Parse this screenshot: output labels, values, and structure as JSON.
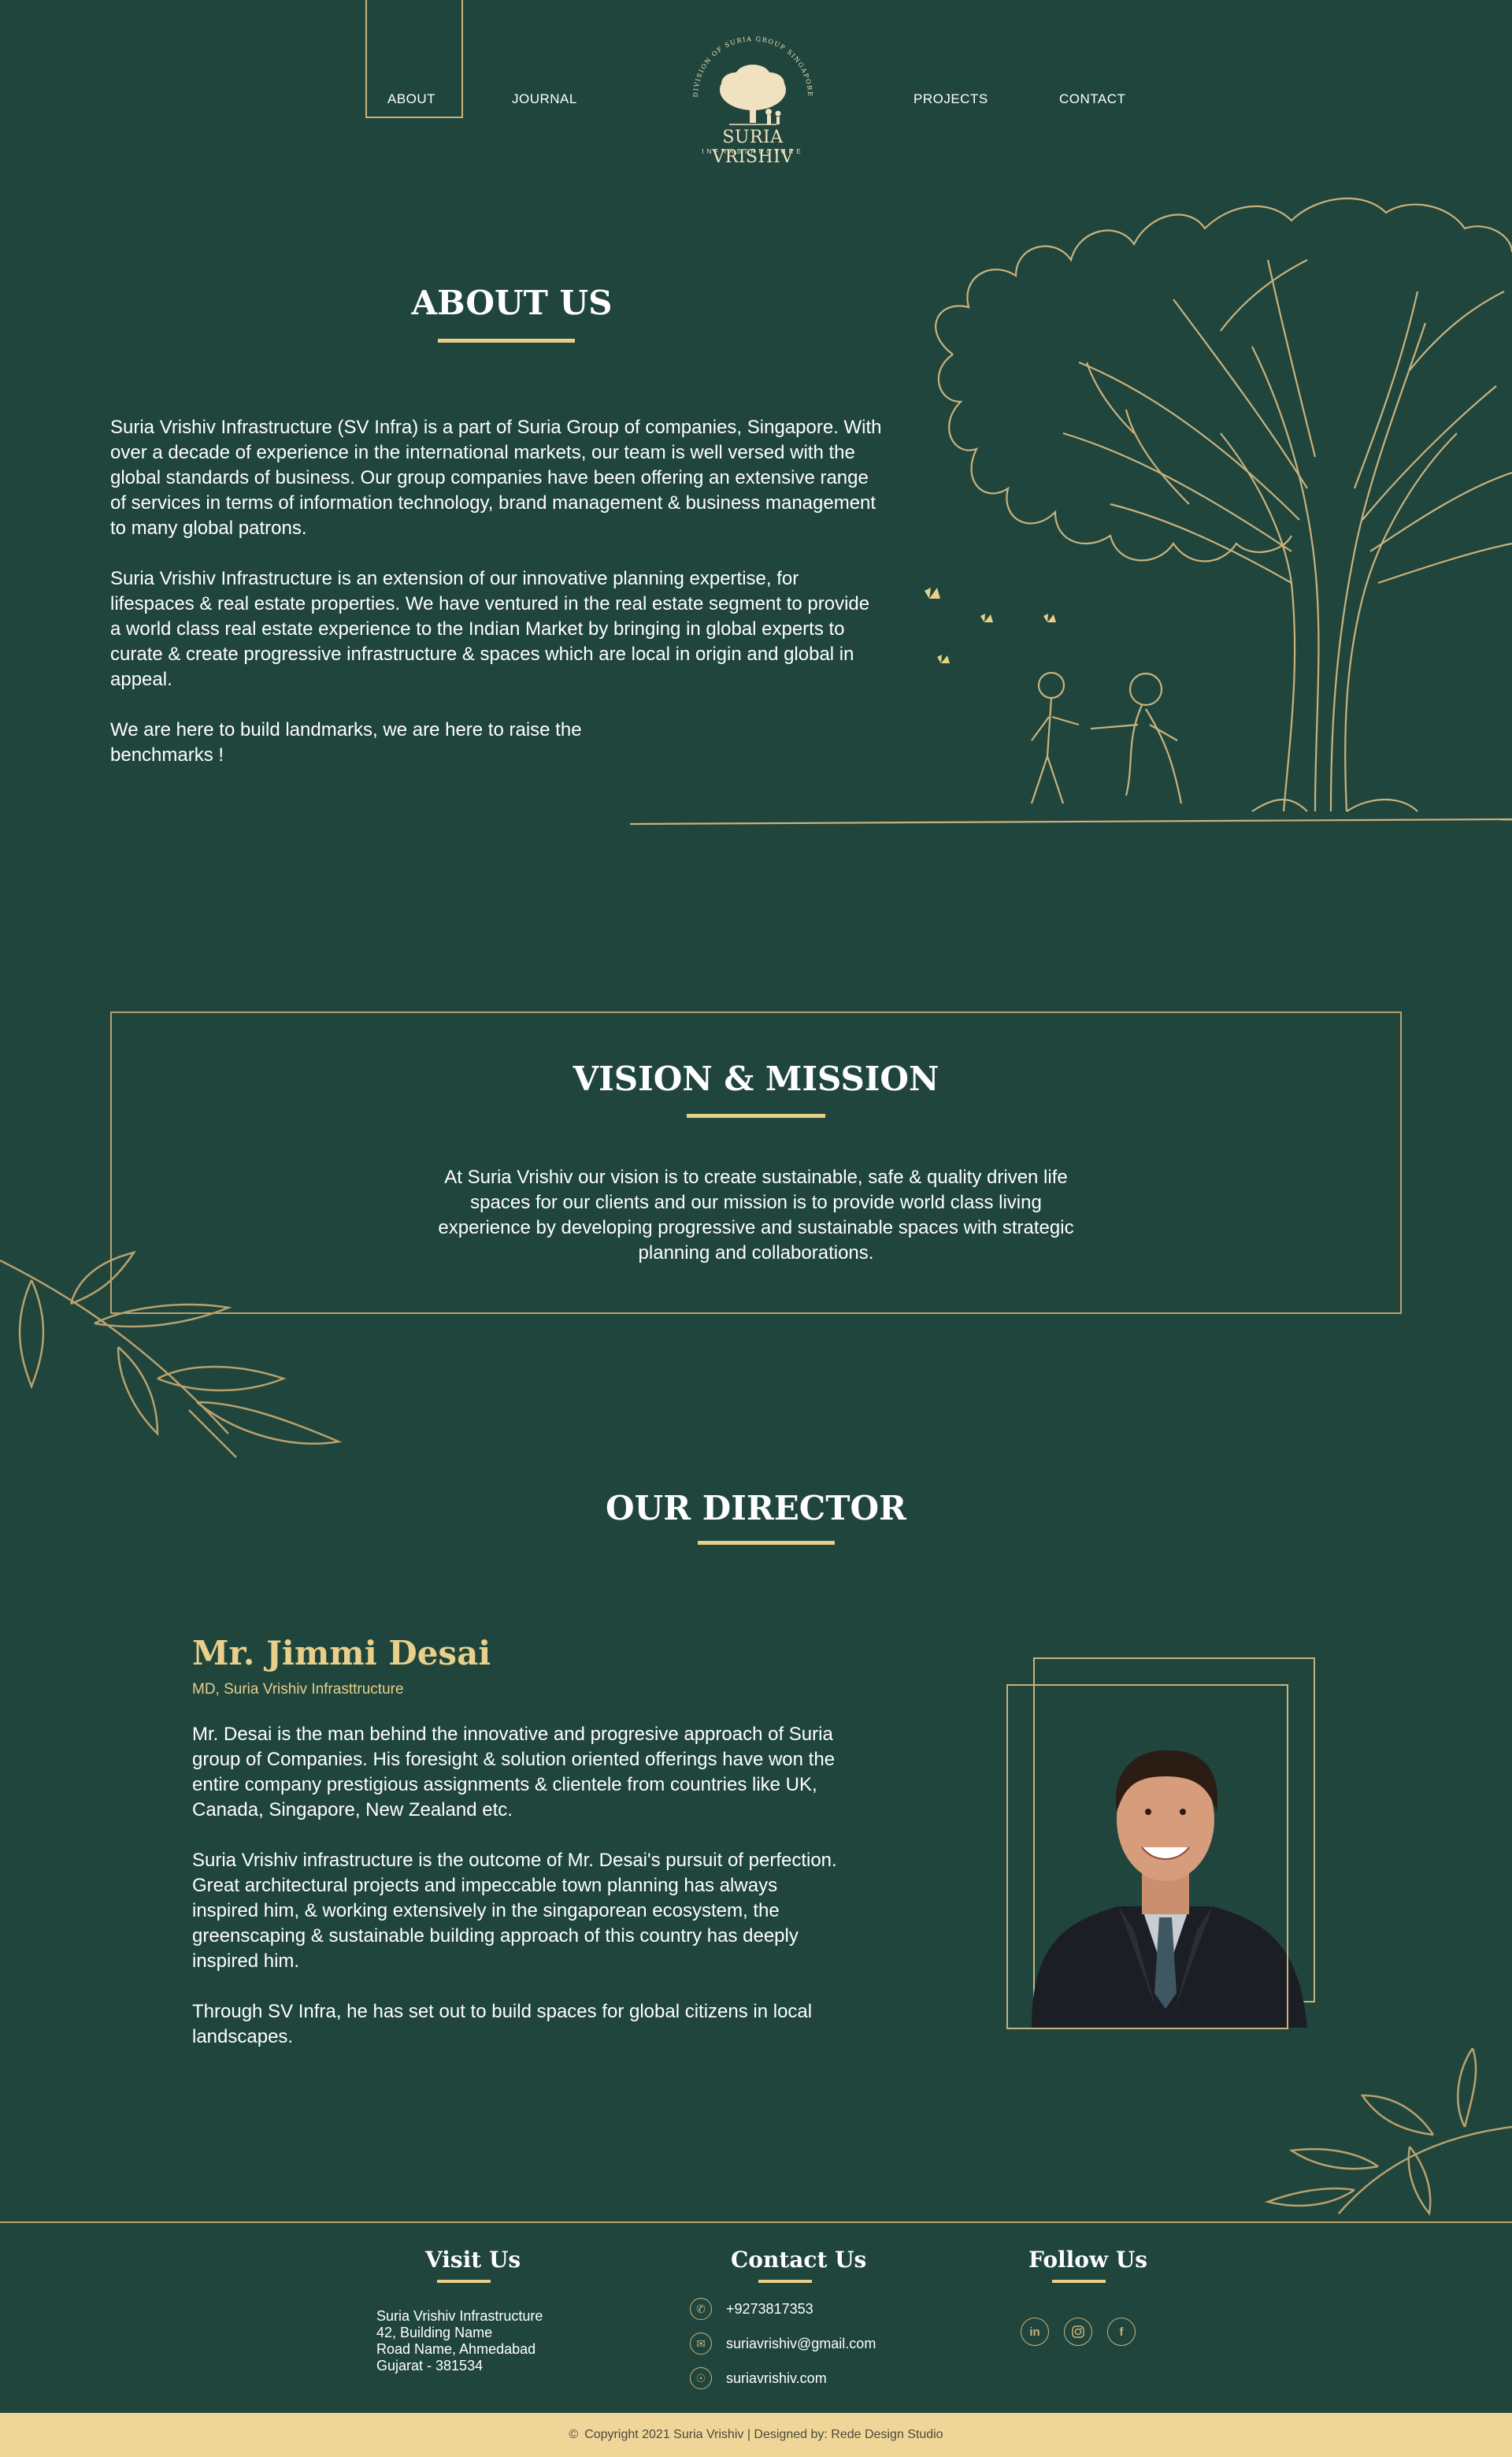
{
  "nav": {
    "items": [
      {
        "label": "ABOUT",
        "active": true
      },
      {
        "label": "JOURNAL",
        "active": false
      },
      {
        "label": "PROJECTS",
        "active": false
      },
      {
        "label": "CONTACT",
        "active": false
      }
    ],
    "logo": {
      "arc_text": "DIVISION OF SURIA GROUP SINGAPORE",
      "name": "SURIA VRISHIV",
      "tagline": "INFRASTRUCTURE"
    }
  },
  "about": {
    "title": "ABOUT US",
    "paragraphs": [
      "Suria Vrishiv Infrastructure (SV Infra)  is a part of Suria Group of companies, Singapore. With over a decade of experience in the international markets, our team is well versed with the global standards of business. Our group companies have been offering  an extensive range of services in terms of information technology, brand management & business management to many global patrons.",
      "Suria Vrishiv Infrastructure is an extension of our innovative planning expertise, for lifespaces & real estate properties. We have ventured in the real estate segment to provide a world class real estate experience to the Indian Market by bringing in global experts to curate & create progressive infrastructure & spaces which are local in origin and global in appeal.",
      "We are here to build landmarks, we are here to raise the benchmarks !"
    ]
  },
  "vision": {
    "title": "VISION & MISSION",
    "text": "At Suria Vrishiv our vision is to create sustainable, safe & quality driven life spaces for our clients and our mission is to provide world class living experience by developing  progressive and sustainable spaces with strategic planning and collaborations."
  },
  "director": {
    "section_title": "OUR DIRECTOR",
    "name": "Mr. Jimmi Desai",
    "role": "MD, Suria Vrishiv Infrasttructure",
    "paragraphs": [
      "Mr. Desai is the man behind the innovative and progresive approach of Suria group of Companies.  His foresight & solution oriented offerings have won the entire company prestigious assignments & clientele from countries like  UK, Canada, Singapore, New Zealand etc.",
      "Suria Vrishiv infrastructure is the outcome of Mr. Desai's pursuit of perfection.  Great architectural projects and impeccable town planning has always inspired him, & working extensively in the singaporean ecosystem, the greenscaping & sustainable building approach of this country has deeply inspired him.",
      "Through SV Infra, he has set out to build spaces for global citizens in local landscapes."
    ]
  },
  "footer": {
    "visit": {
      "title": "Visit Us",
      "lines": [
        "Suria Vrishiv Infrastructure",
        "42, Building Name",
        "Road Name, Ahmedabad",
        "Gujarat - 381534"
      ]
    },
    "contact": {
      "title": "Contact Us",
      "phone": "+9273817353",
      "email": "suriavrishiv@gmail.com",
      "website": "suriavrishiv.com"
    },
    "follow": {
      "title": "Follow Us",
      "icons": [
        "linkedin-icon",
        "instagram-icon",
        "facebook-icon"
      ]
    },
    "copyright": "Copyright 2021  Suria Vrishiv  |  Designed by: Rede Design Studio"
  },
  "colors": {
    "background": "#1f453d",
    "gold": "#e8cf8a",
    "line_gold": "#c9b27c",
    "footer_bar": "#efd698"
  }
}
